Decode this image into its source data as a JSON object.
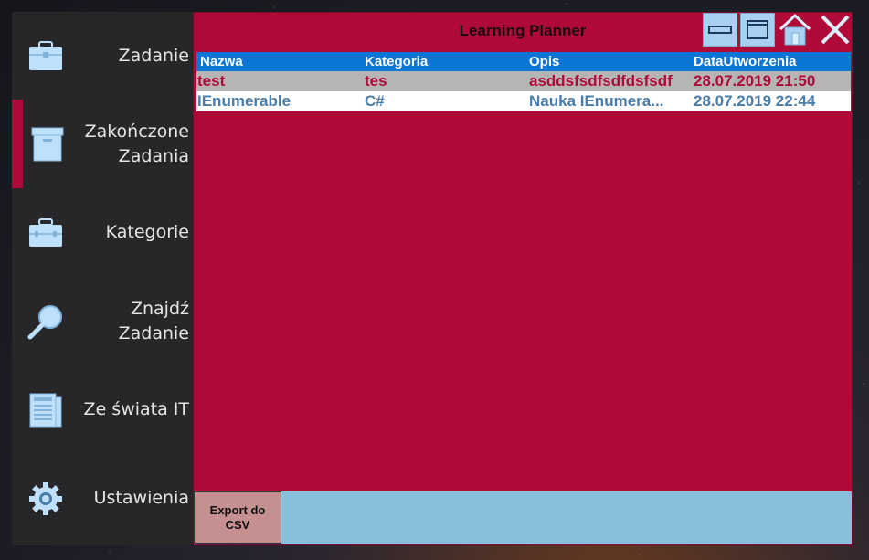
{
  "sidebar": {
    "items": [
      {
        "label": "Zadanie",
        "icon": "briefcase-icon"
      },
      {
        "label": "Zakończone Zadania",
        "icon": "archive-box-icon"
      },
      {
        "label": "Kategorie",
        "icon": "toolbox-icon"
      },
      {
        "label": "Znajdź Zadanie",
        "icon": "magnifier-icon"
      },
      {
        "label": "Ze świata IT",
        "icon": "newspaper-icon"
      },
      {
        "label": "Ustawienia",
        "icon": "gear-icon"
      }
    ],
    "active_index": 1,
    "active_color": "#b00a38"
  },
  "window": {
    "title": "Learning Planner",
    "buttons": [
      "minimize-icon",
      "maximize-icon",
      "home-icon",
      "close-icon"
    ]
  },
  "table": {
    "columns": [
      "Nazwa",
      "Kategoria",
      "Opis",
      "DataUtworzenia"
    ],
    "rows": [
      [
        "test",
        "tes",
        "asddsfsdfsdfdsfsdf",
        "28.07.2019 21:50"
      ],
      [
        "IEnumerable",
        "C#",
        "Nauka IEnumera...",
        "28.07.2019 22:44"
      ]
    ]
  },
  "footer": {
    "export_label": "Export do\nCSV"
  },
  "colors": {
    "accent": "#b00a38",
    "header": "#0b76d6",
    "footer": "#88c0dc",
    "sidebar": "#272729"
  }
}
